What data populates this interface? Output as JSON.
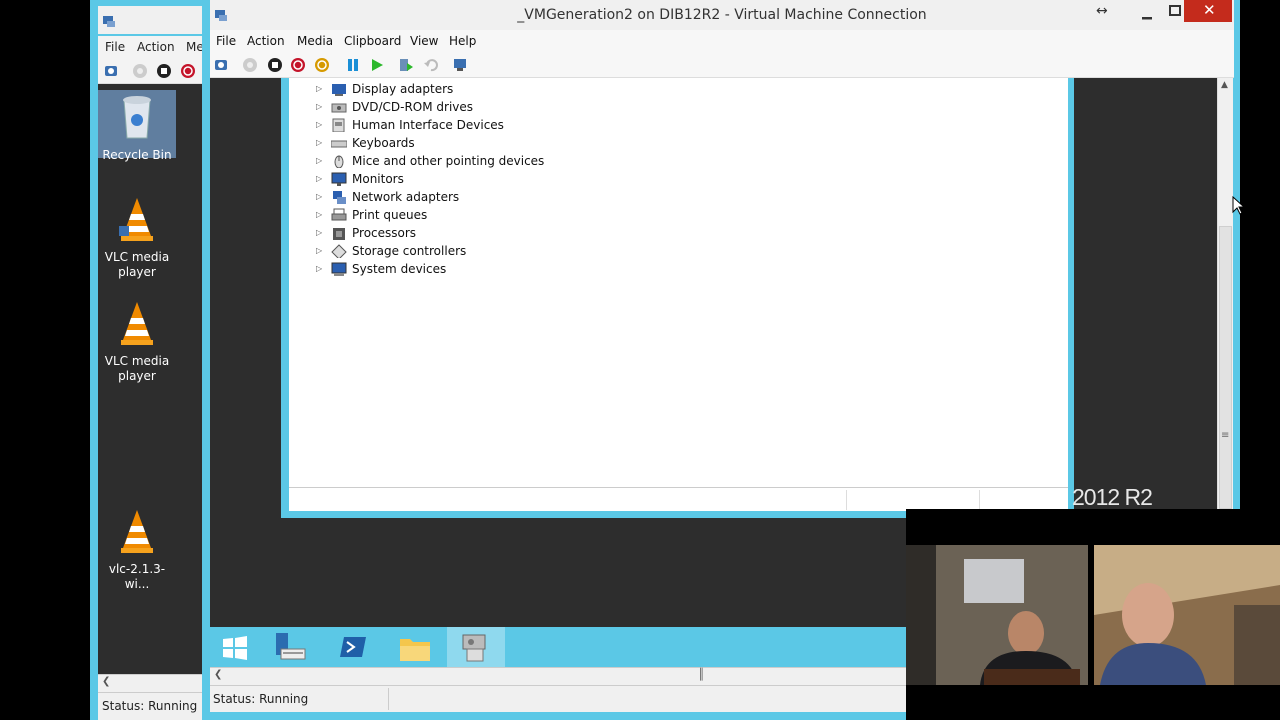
{
  "back_window": {
    "menu": [
      "File",
      "Action",
      "Me"
    ],
    "desktop_icons": [
      {
        "label": "Recycle Bin",
        "icon": "recycle-bin-icon"
      },
      {
        "label": "VLC media player",
        "icon": "vlc-icon"
      },
      {
        "label": "VLC media player",
        "icon": "vlc-icon"
      },
      {
        "label": "vlc-2.1.3-wi...",
        "icon": "vlc-icon"
      }
    ],
    "status": "Status: Running"
  },
  "main_window": {
    "title": "_VMGeneration2 on DIB12R2 - Virtual Machine Connection",
    "menu": [
      "File",
      "Action",
      "Media",
      "Clipboard",
      "View",
      "Help"
    ],
    "status": "Status: Running"
  },
  "device_manager": {
    "items": [
      {
        "label": "Display adapters",
        "icon": "display-adapter-icon"
      },
      {
        "label": "DVD/CD-ROM drives",
        "icon": "dvd-drive-icon"
      },
      {
        "label": "Human Interface Devices",
        "icon": "hid-icon"
      },
      {
        "label": "Keyboards",
        "icon": "keyboard-icon"
      },
      {
        "label": "Mice and other pointing devices",
        "icon": "mouse-icon"
      },
      {
        "label": "Monitors",
        "icon": "monitor-icon"
      },
      {
        "label": "Network adapters",
        "icon": "network-adapter-icon"
      },
      {
        "label": "Print queues",
        "icon": "printer-icon"
      },
      {
        "label": "Processors",
        "icon": "processor-icon"
      },
      {
        "label": "Storage controllers",
        "icon": "storage-controller-icon"
      },
      {
        "label": "System devices",
        "icon": "system-devices-icon"
      }
    ]
  },
  "guest_desktop": {
    "brand": "2012 R2"
  },
  "colors": {
    "accent": "#5bc8e6",
    "close_red": "#c42b1c",
    "desktop": "#2d2d2d"
  }
}
